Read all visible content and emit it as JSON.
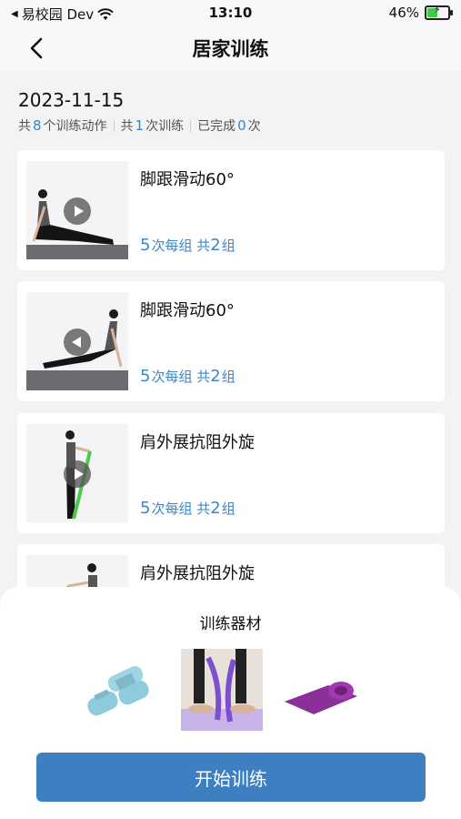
{
  "status_bar": {
    "carrier": "易校园 Dev",
    "time": "13:10",
    "battery": "46%",
    "battery_level": 0.46
  },
  "nav": {
    "title": "居家训练"
  },
  "summary": {
    "date": "2023-11-15",
    "actions_prefix": "共",
    "actions_count": "8",
    "actions_suffix": "个训练动作",
    "sessions_prefix": "共",
    "sessions_count": "1",
    "sessions_suffix": "次训练",
    "done_prefix": "已完成",
    "done_count": "0",
    "done_suffix": "次"
  },
  "exercises": [
    {
      "name": "脚跟滑动60°",
      "reps": "5",
      "reps_label": "次每组",
      "sets_prefix": "共",
      "sets": "2",
      "sets_label": "组"
    },
    {
      "name": "脚跟滑动60°",
      "reps": "5",
      "reps_label": "次每组",
      "sets_prefix": "共",
      "sets": "2",
      "sets_label": "组"
    },
    {
      "name": "肩外展抗阻外旋",
      "reps": "5",
      "reps_label": "次每组",
      "sets_prefix": "共",
      "sets": "2",
      "sets_label": "组"
    },
    {
      "name": "肩外展抗阻外旋"
    }
  ],
  "equipment_sheet": {
    "title": "训练器材",
    "items": [
      "dumbbell-icon",
      "resistance-band-image",
      "yoga-mat-icon"
    ],
    "start_button": "开始训练"
  },
  "colors": {
    "accent": "#3a86c8",
    "button": "#3d7fc1",
    "battery": "#43c94a"
  }
}
